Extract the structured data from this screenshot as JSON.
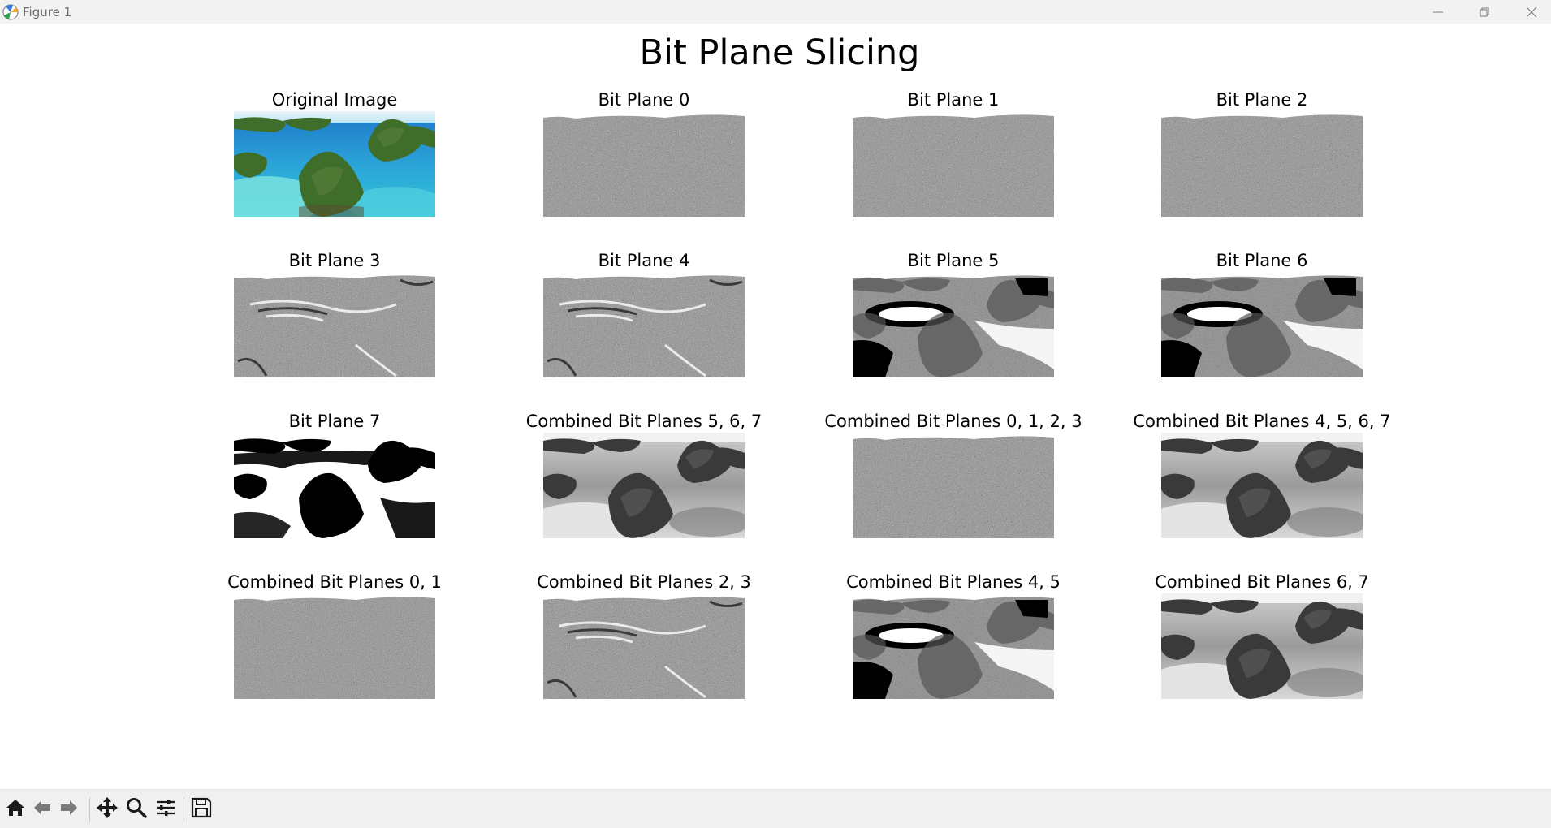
{
  "window": {
    "title": "Figure 1"
  },
  "figure": {
    "suptitle": "Bit Plane Slicing",
    "panels": [
      {
        "title": "Original Image",
        "kind": "color"
      },
      {
        "title": "Bit Plane 0",
        "kind": "noise"
      },
      {
        "title": "Bit Plane 1",
        "kind": "noise"
      },
      {
        "title": "Bit Plane 2",
        "kind": "noise"
      },
      {
        "title": "Bit Plane 3",
        "kind": "bitmid"
      },
      {
        "title": "Bit Plane 4",
        "kind": "bitmid"
      },
      {
        "title": "Bit Plane 5",
        "kind": "bithigh"
      },
      {
        "title": "Bit Plane 6",
        "kind": "bithigh"
      },
      {
        "title": "Bit Plane 7",
        "kind": "binary"
      },
      {
        "title": "Combined Bit Planes 5, 6, 7",
        "kind": "gray"
      },
      {
        "title": "Combined Bit Planes 0, 1, 2, 3",
        "kind": "noise"
      },
      {
        "title": "Combined Bit Planes 4, 5, 6, 7",
        "kind": "gray"
      },
      {
        "title": "Combined Bit Planes 0, 1",
        "kind": "noise"
      },
      {
        "title": "Combined Bit Planes 2, 3",
        "kind": "bitmid"
      },
      {
        "title": "Combined Bit Planes 4, 5",
        "kind": "bithigh"
      },
      {
        "title": "Combined Bit Planes 6, 7",
        "kind": "gray"
      }
    ]
  },
  "toolbar": {
    "buttons": [
      {
        "icon": "home-icon"
      },
      {
        "icon": "back-arrow-icon"
      },
      {
        "icon": "forward-arrow-icon"
      },
      {
        "icon": "pan-move-icon"
      },
      {
        "icon": "zoom-magnifier-icon"
      },
      {
        "icon": "configure-subplots-icon"
      },
      {
        "icon": "save-floppy-icon"
      }
    ]
  },
  "colors": {
    "titlebar_bg": "#f3f3f3",
    "toolbar_bg": "#f0f0f0",
    "sea_turquoise": "#2fc6d6",
    "sea_deep": "#1f78c8",
    "island_green": "#3f6e2a"
  }
}
